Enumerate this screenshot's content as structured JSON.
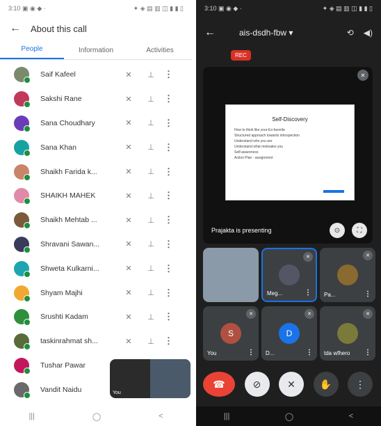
{
  "left_status": {
    "left": "3:10 ▣ ◉ ◆ ·",
    "right": "✦ ◈ ▤ ▥ ◫ ▮ ▮ ▯"
  },
  "about": {
    "title": "About this call",
    "tabs": [
      "People",
      "Information",
      "Activities"
    ],
    "active_tab": "People",
    "participants": [
      {
        "name": "Saif Kafeel",
        "color": "#7a8a6a"
      },
      {
        "name": "Sakshi Rane",
        "color": "#c0395a"
      },
      {
        "name": "Sana Choudhary",
        "color": "#6a3db8"
      },
      {
        "name": "Sana Khan",
        "color": "#17a2a2"
      },
      {
        "name": "Shaikh Farida k...",
        "color": "#c8856a"
      },
      {
        "name": "SHAIKH MAHEK",
        "color": "#e08aa8"
      },
      {
        "name": "Shaikh Mehtab ...",
        "color": "#7a5a3a"
      },
      {
        "name": "Shravani Sawan...",
        "color": "#3a3a5a"
      },
      {
        "name": "Shweta Kulkarni...",
        "color": "#1da5b0"
      },
      {
        "name": "Shyam Majhi",
        "color": "#f0a830"
      },
      {
        "name": "Srushti Kadam",
        "color": "#2f8f3a"
      },
      {
        "name": "taskinrahmat sh...",
        "color": "#5a6a3a"
      },
      {
        "name": "Tushar Pawar",
        "color": "#c2185b"
      },
      {
        "name": "Vandit Naidu",
        "color": "#6a6a6a"
      }
    ],
    "pip": {
      "label_you": "You"
    }
  },
  "right_status": {
    "left": "3:10 ▣ ◉ ◆ ·",
    "right": "✦ ◈ ▤ ▥ ◫ ▮ ▮ ▯"
  },
  "meet": {
    "meeting_name": "ais-dsdh-fbw",
    "rec_label": "REC",
    "slide_title": "Self-Discovery",
    "slide_items": [
      "How to think like your-Ex-favorite",
      "Structured approach towards introspection",
      "Understand who you are",
      "Understand what motivates you",
      "Self-awareness",
      "Action Plan - assignment"
    ],
    "presenting_text": "Prajakta is presenting",
    "tiles": [
      {
        "name": "",
        "initial": "",
        "color": ""
      },
      {
        "name": "Meg...",
        "initial": "",
        "color": "#556"
      },
      {
        "name": "Pa...",
        "initial": "",
        "color": "#8a6a30"
      },
      {
        "name": "You",
        "initial": "S",
        "color": "#b05040"
      },
      {
        "name": "D...",
        "initial": "D",
        "color": "#1a73e8"
      },
      {
        "name": "tda wfhero",
        "initial": "",
        "color": "#7a7a3a"
      }
    ]
  },
  "nav": {
    "recent": "|||",
    "home": "◯",
    "back": "<"
  },
  "icons": {
    "mic_off": "mic-off-icon",
    "pin": "pin-icon",
    "more": "more-vert-icon"
  }
}
